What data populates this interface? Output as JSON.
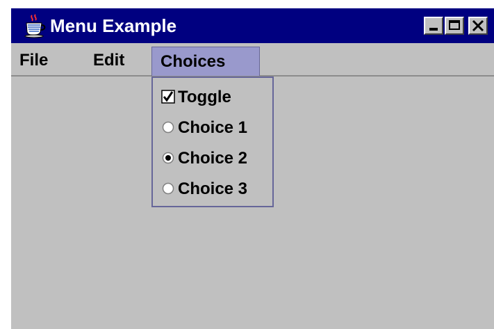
{
  "window": {
    "title": "Menu Example",
    "icon": "java-cup-icon"
  },
  "title_buttons": {
    "minimize": "minimize-icon",
    "maximize": "maximize-icon",
    "close": "close-icon"
  },
  "menubar": {
    "items": [
      {
        "label": "File"
      },
      {
        "label": "Edit"
      },
      {
        "label": "Choices",
        "state": "open"
      }
    ]
  },
  "dropdown": {
    "menu": "Choices",
    "items": [
      {
        "label": "Toggle",
        "type": "checkbox",
        "checked": true
      },
      {
        "label": "Choice 1",
        "type": "radio",
        "selected": false
      },
      {
        "label": "Choice 2",
        "type": "radio",
        "selected": true
      },
      {
        "label": "Choice 3",
        "type": "radio",
        "selected": false
      }
    ]
  },
  "colors": {
    "titlebar": "#000080",
    "window_bg": "#c0c0c0",
    "menu_highlight": "#9999cc",
    "menu_border": "#666699"
  }
}
